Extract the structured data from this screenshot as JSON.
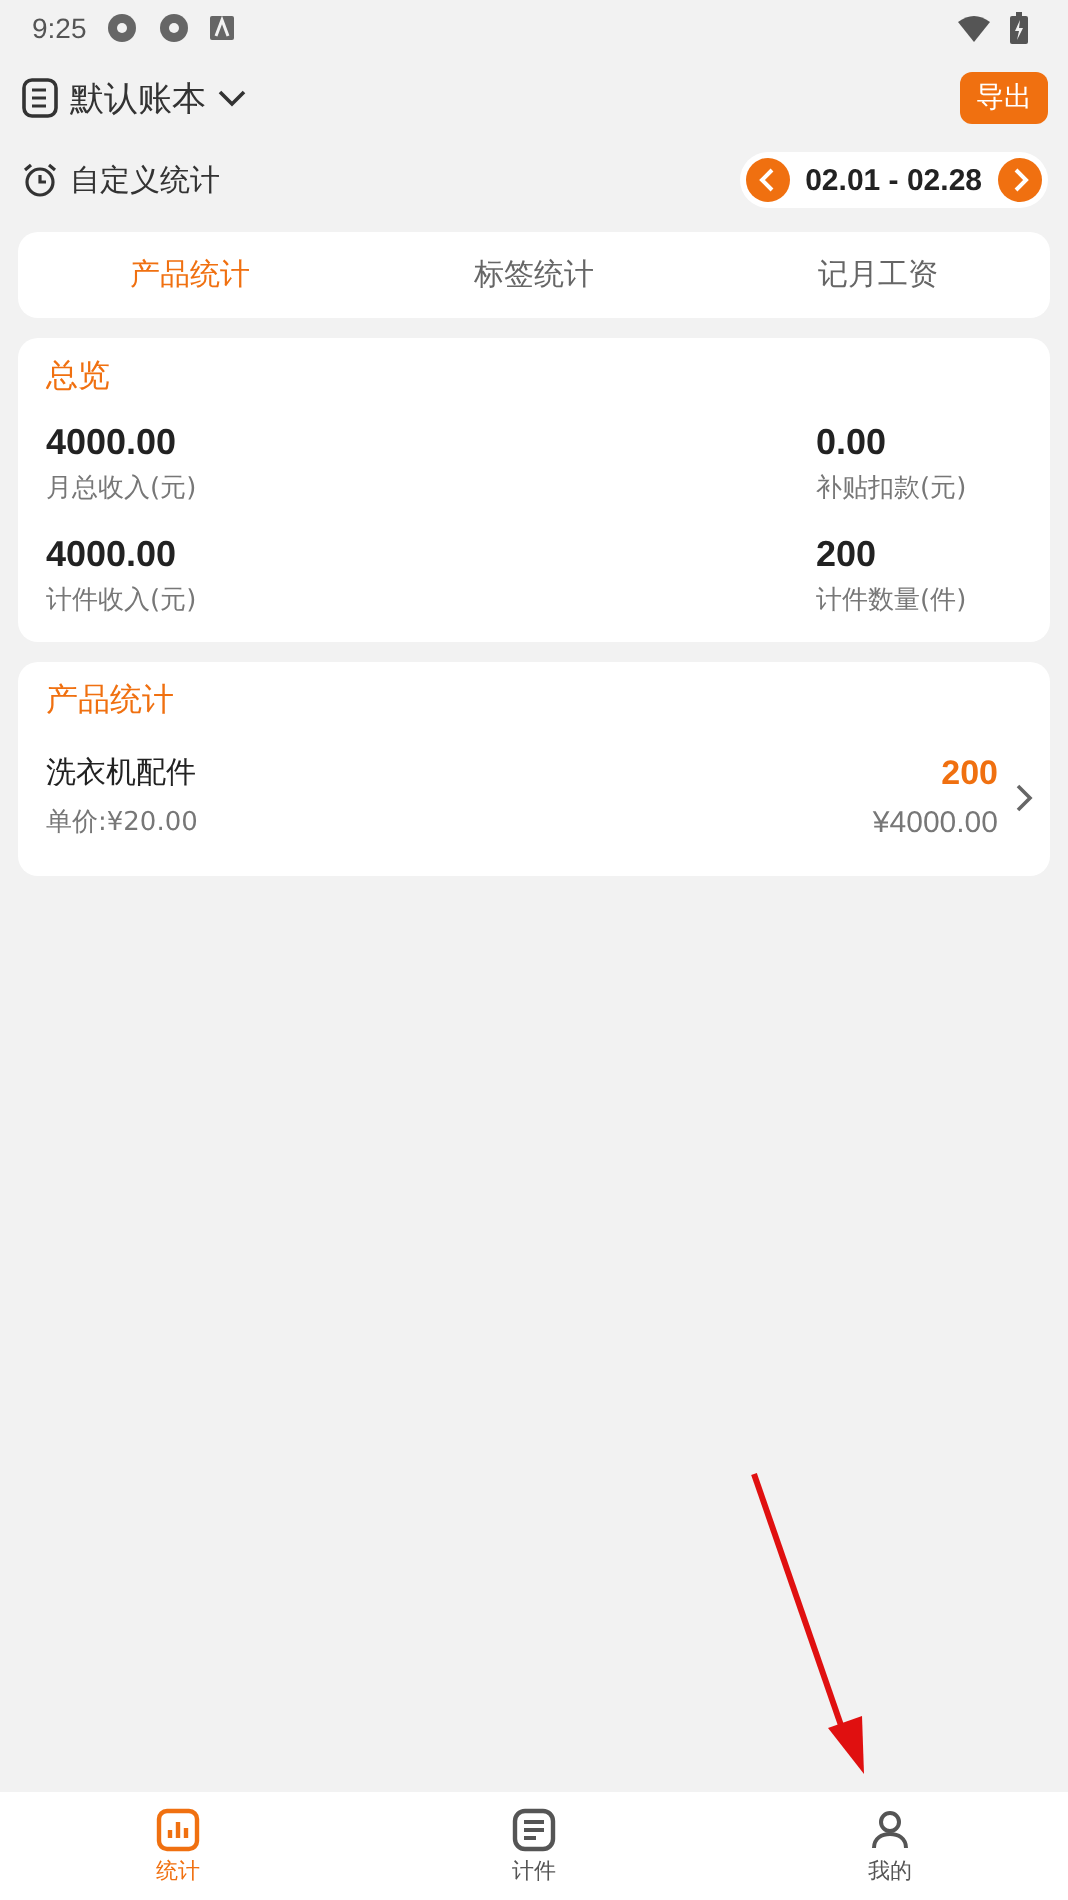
{
  "status_bar": {
    "time": "9:25"
  },
  "header": {
    "book": "默认账本",
    "export_button": "导出"
  },
  "filter": {
    "label": "自定义统计",
    "date_range": "02.01 - 02.28"
  },
  "tabs": [
    {
      "label": "产品统计",
      "selected": true
    },
    {
      "label": "标签统计",
      "selected": false
    },
    {
      "label": "记月工资",
      "selected": false
    }
  ],
  "overview": {
    "title": "总览",
    "stats": [
      {
        "value": "4000.00",
        "label": "月总收入(元)"
      },
      {
        "value": "0.00",
        "label": "补贴扣款(元)"
      },
      {
        "value": "4000.00",
        "label": "计件收入(元)"
      },
      {
        "value": "200",
        "label": "计件数量(件)"
      }
    ]
  },
  "products": {
    "title": "产品统计",
    "items": [
      {
        "name": "洗衣机配件",
        "unit_price": "单价:¥20.00",
        "count": "200",
        "amount": "¥4000.00"
      }
    ]
  },
  "bottom_nav": [
    {
      "label": "统计",
      "kind": "chart",
      "selected": true
    },
    {
      "label": "计件",
      "kind": "list",
      "selected": false
    },
    {
      "label": "我的",
      "kind": "person",
      "selected": false
    }
  ]
}
